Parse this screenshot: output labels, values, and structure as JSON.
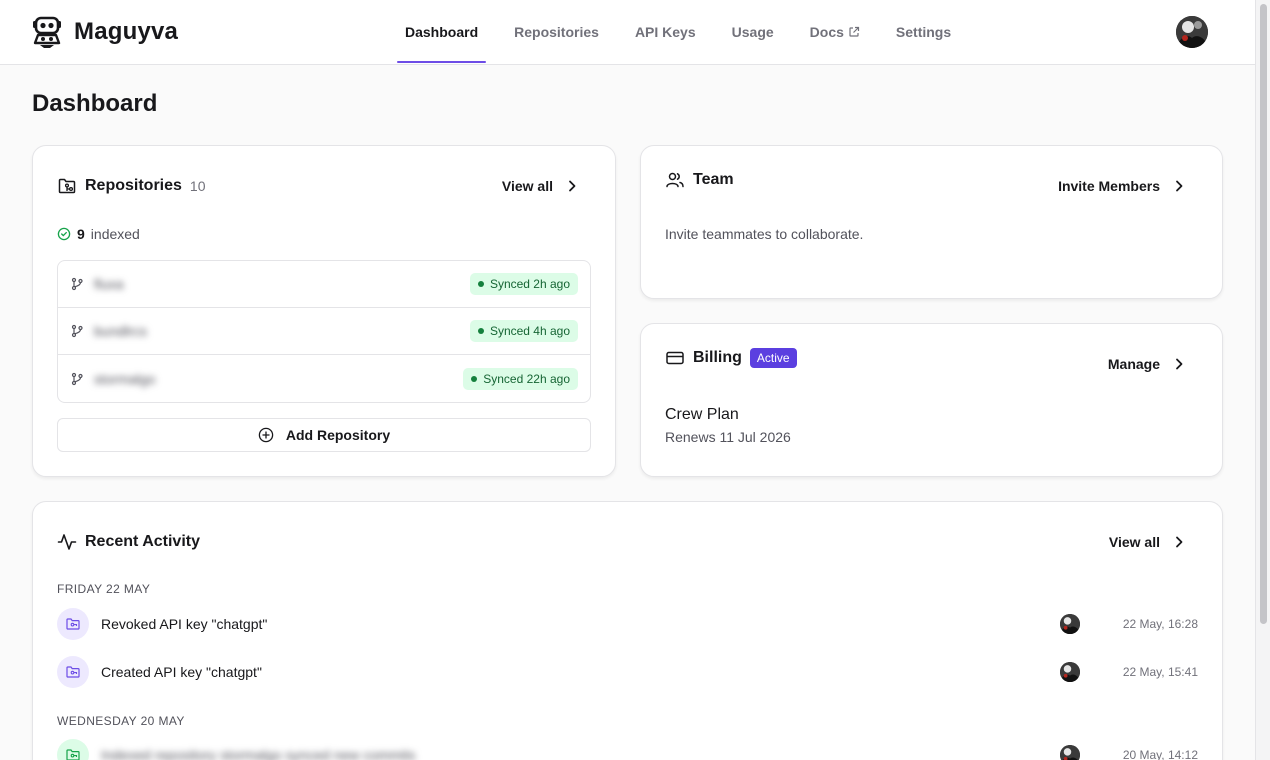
{
  "app": {
    "name": "Maguyva"
  },
  "nav": {
    "items": [
      {
        "label": "Dashboard",
        "active": true
      },
      {
        "label": "Repositories"
      },
      {
        "label": "API Keys"
      },
      {
        "label": "Usage"
      },
      {
        "label": "Docs",
        "external": true
      },
      {
        "label": "Settings"
      }
    ]
  },
  "page": {
    "title": "Dashboard"
  },
  "repositories": {
    "title": "Repositories",
    "count": "10",
    "view_all": "View all",
    "indexed_count": "9",
    "indexed_label": "indexed",
    "items": [
      {
        "name": "fluxa",
        "status": "Synced 2h ago"
      },
      {
        "name": "bundlrcs",
        "status": "Synced 4h ago"
      },
      {
        "name": "stormalgo",
        "status": "Synced 22h ago"
      }
    ],
    "add_label": "Add Repository"
  },
  "team": {
    "title": "Team",
    "action": "Invite Members",
    "description": "Invite teammates to collaborate."
  },
  "billing": {
    "title": "Billing",
    "badge": "Active",
    "action": "Manage",
    "plan": "Crew Plan",
    "renewal": "Renews 11 Jul 2026"
  },
  "activity": {
    "title": "Recent Activity",
    "view_all": "View all",
    "groups": [
      {
        "label": "FRIDAY 22 MAY",
        "items": [
          {
            "text": "Revoked API key \"chatgpt\"",
            "time": "22 May, 16:28",
            "icon": "folder-key-icon"
          },
          {
            "text": "Created API key \"chatgpt\"",
            "time": "22 May, 15:41",
            "icon": "folder-key-icon"
          }
        ]
      },
      {
        "label": "WEDNESDAY 20 MAY",
        "items": [
          {
            "text": "Indexed repository stormalgo synced new commits",
            "time": "20 May, 14:12",
            "icon": "folder-sync-icon"
          }
        ]
      }
    ]
  },
  "colors": {
    "accent": "#6d4de6",
    "badge": "#5b3fe0",
    "success_bg": "#dcfce7",
    "success_text": "#166534"
  }
}
